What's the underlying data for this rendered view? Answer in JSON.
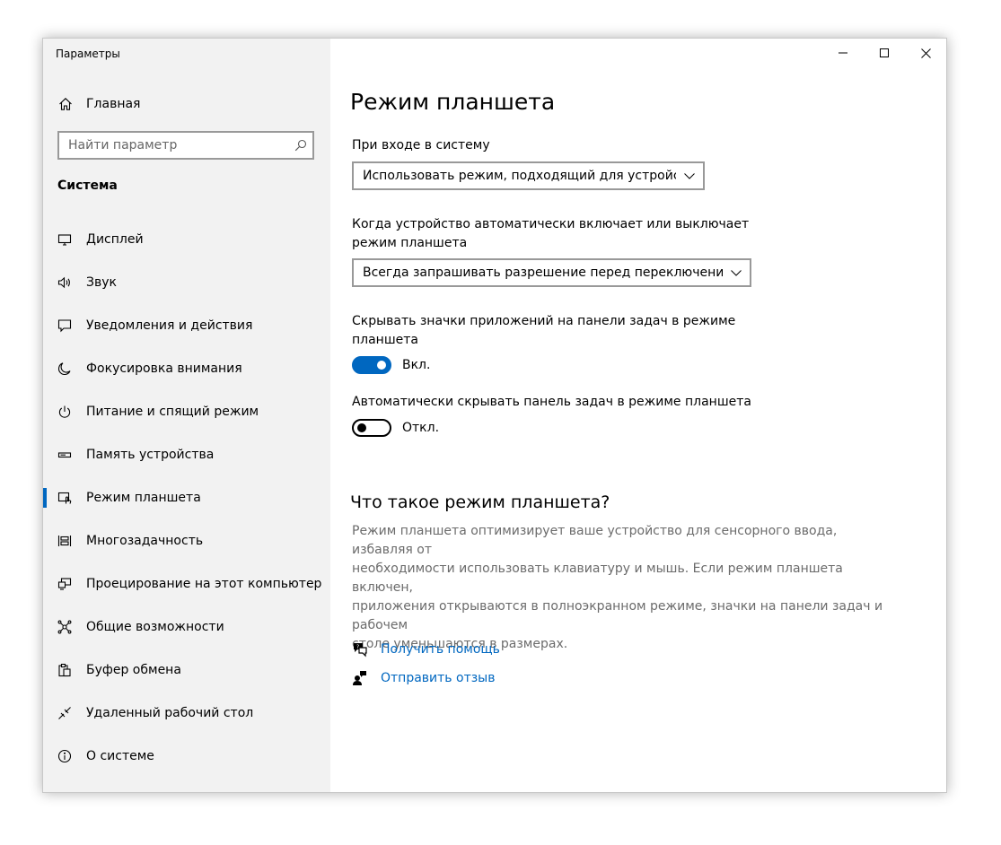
{
  "window": {
    "title": "Параметры",
    "minimize_icon": "minimize-icon",
    "maximize_icon": "maximize-icon",
    "close_icon": "close-icon"
  },
  "sidebar": {
    "home_label": "Главная",
    "search_placeholder": "Найти параметр",
    "section_title": "Система",
    "items": [
      {
        "label": "Дисплей",
        "icon": "display-icon"
      },
      {
        "label": "Звук",
        "icon": "speaker-icon"
      },
      {
        "label": "Уведомления и действия",
        "icon": "notification-icon"
      },
      {
        "label": "Фокусировка внимания",
        "icon": "moon-icon"
      },
      {
        "label": "Питание и спящий режим",
        "icon": "power-icon"
      },
      {
        "label": "Память устройства",
        "icon": "storage-icon"
      },
      {
        "label": "Режим планшета",
        "icon": "tablet-mode-icon",
        "active": true
      },
      {
        "label": "Многозадачность",
        "icon": "multitasking-icon"
      },
      {
        "label": "Проецирование на этот компьютер",
        "icon": "projecting-icon"
      },
      {
        "label": "Общие возможности",
        "icon": "shared-experiences-icon"
      },
      {
        "label": "Буфер обмена",
        "icon": "clipboard-icon"
      },
      {
        "label": "Удаленный рабочий стол",
        "icon": "remote-desktop-icon"
      },
      {
        "label": "О системе",
        "icon": "info-icon"
      }
    ]
  },
  "main": {
    "title": "Режим планшета",
    "signin_label": "При входе в систему",
    "signin_value": "Использовать режим, подходящий для устройства",
    "switch_label_line1": "Когда устройство автоматически включает или выключает",
    "switch_label_line2": "режим планшета",
    "switch_value": "Всегда запрашивать разрешение перед переключением...",
    "hide_icons_label_line1": "Скрывать значки приложений на панели задач в режиме",
    "hide_icons_label_line2": "планшета",
    "hide_icons_state": "Вкл.",
    "hide_icons_on": true,
    "autohide_label": "Автоматически скрывать панель задач в режиме планшета",
    "autohide_state": "Откл.",
    "autohide_on": false,
    "what_is_heading": "Что такое режим планшета?",
    "description": [
      "Режим планшета оптимизирует ваше устройство для сенсорного ввода, избавляя от",
      "необходимости использовать клавиатуру и мышь. Если режим планшета включен,",
      "приложения открываются в полноэкранном режиме, значки на панели задач и рабочем",
      "столе уменьшаются в размерах."
    ],
    "help_link": "Получить помощь",
    "feedback_link": "Отправить отзыв"
  },
  "colors": {
    "accent": "#0067c0",
    "sidebar_bg": "#f2f2f2",
    "description_text": "#6b6b6b"
  }
}
